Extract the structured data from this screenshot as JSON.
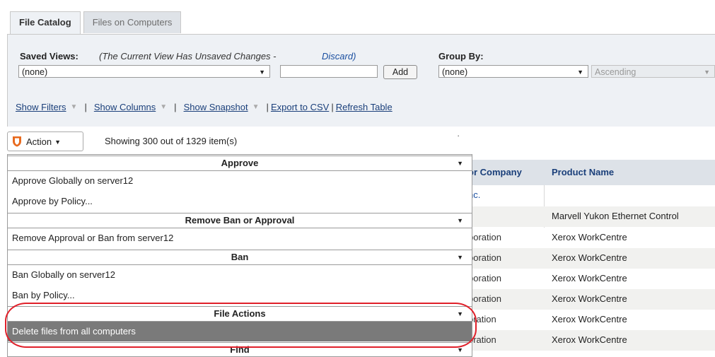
{
  "tabs": [
    "File Catalog",
    "Files on Computers"
  ],
  "saved_views": {
    "label": "Saved Views:",
    "unsaved_note": "(The Current View Has Unsaved Changes - ",
    "discard": "Discard)",
    "selected": "(none)",
    "add_label": "Add"
  },
  "group_by": {
    "label": "Group By:",
    "selected": "(none)",
    "order": "Ascending"
  },
  "toolbar": {
    "show_filters": "Show Filters",
    "show_columns": "Show Columns",
    "show_snapshot": "Show Snapshot",
    "export_csv": "Export to CSV",
    "refresh": "Refresh Table"
  },
  "action": {
    "label": "Action",
    "showing": "Showing 300 out of 1329 item(s)"
  },
  "table": {
    "headers": [
      "or Company",
      "Product Name"
    ],
    "rows": [
      {
        "vendor": "nc.",
        "product": ""
      },
      {
        "vendor": "",
        "product": "Marvell Yukon Ethernet Control"
      },
      {
        "vendor": "poration",
        "product": "Xerox WorkCentre"
      },
      {
        "vendor": "poration",
        "product": "Xerox WorkCentre"
      },
      {
        "vendor": "poration",
        "product": "Xerox WorkCentre"
      },
      {
        "vendor": "poration",
        "product": "Xerox WorkCentre"
      },
      {
        "vendor": "oration",
        "product": "Xerox WorkCentre"
      },
      {
        "vendor": "oration",
        "product": "Xerox WorkCentre"
      }
    ]
  },
  "menu": {
    "sections": [
      {
        "title": "Approve",
        "items": [
          "Approve Globally on server12",
          "Approve by Policy..."
        ]
      },
      {
        "title": "Remove Ban or Approval",
        "items": [
          "Remove Approval or Ban from server12"
        ]
      },
      {
        "title": "Ban",
        "items": [
          "Ban Globally on server12",
          "Ban by Policy..."
        ]
      },
      {
        "title": "File Actions",
        "items": [
          "Delete files from all computers"
        ]
      },
      {
        "title": "Find",
        "items": []
      }
    ],
    "selected_item": "Delete files from all computers"
  },
  "colors": {
    "highlight": "#e0202a",
    "selected_bg": "#7a7a7a",
    "link": "#1a3f7a",
    "shield": "#e86a1e"
  }
}
